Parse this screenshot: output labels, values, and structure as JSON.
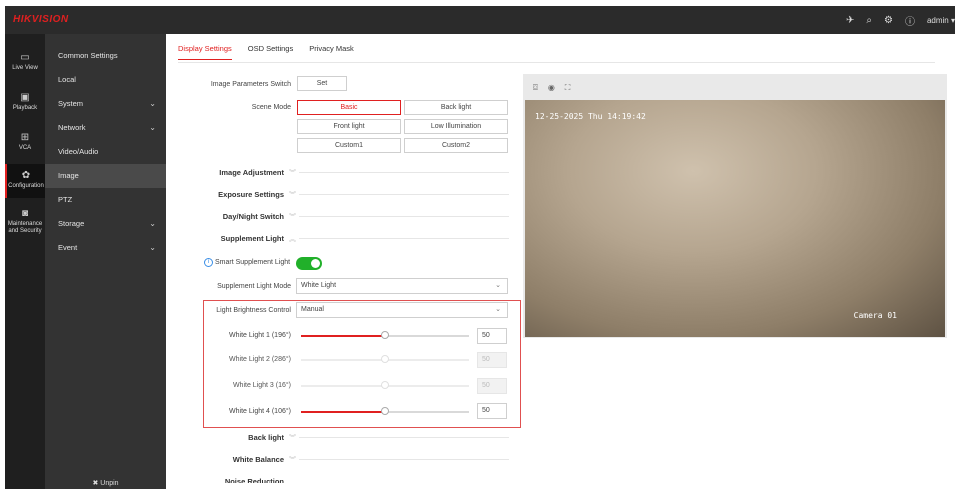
{
  "brand": "HIKVISION",
  "topbar": {
    "user": "admin"
  },
  "leftnav": [
    {
      "label": "Live View",
      "icon": "monitor-icon"
    },
    {
      "label": "Playback",
      "icon": "play-icon"
    },
    {
      "label": "VCA",
      "icon": "vca-icon"
    },
    {
      "label": "Configuration",
      "icon": "gear-icon"
    },
    {
      "label": "Maintenance and Security",
      "icon": "maintenance-icon"
    }
  ],
  "menu": [
    {
      "label": "Common Settings"
    },
    {
      "label": "Local"
    },
    {
      "label": "System"
    },
    {
      "label": "Network"
    },
    {
      "label": "Video/Audio"
    },
    {
      "label": "Image"
    },
    {
      "label": "PTZ"
    },
    {
      "label": "Storage"
    },
    {
      "label": "Event"
    }
  ],
  "unpin": "Unpin",
  "tabs": [
    "Display Settings",
    "OSD Settings",
    "Privacy Mask"
  ],
  "form": {
    "image_params_label": "Image Parameters Switch",
    "set_button": "Set",
    "scene_mode_label": "Scene Mode",
    "scene_options": [
      "Basic",
      "Back light",
      "Front light",
      "Low Illumination",
      "Custom1",
      "Custom2"
    ],
    "sections": [
      "Image Adjustment",
      "Exposure Settings",
      "Day/Night Switch",
      "Supplement Light",
      "Back light",
      "White Balance",
      "Noise Reduction"
    ],
    "smart_supplement_label": "Smart Supplement Light",
    "smart_supplement_on": true,
    "supplement_mode_label": "Supplement Light Mode",
    "supplement_mode_value": "White Light",
    "brightness_control_label": "Light Brightness Control",
    "brightness_control_value": "Manual",
    "white_lights": [
      {
        "label": "White Light 1 (196°)",
        "value": "50",
        "enabled": true,
        "level": 50
      },
      {
        "label": "White Light 2 (286°)",
        "value": "50",
        "enabled": false,
        "level": 50
      },
      {
        "label": "White Light 3 (16°)",
        "value": "50",
        "enabled": false,
        "level": 50
      },
      {
        "label": "White Light 4 (106°)",
        "value": "50",
        "enabled": true,
        "level": 50
      }
    ]
  },
  "preview": {
    "osd_time": "12-25-2025 Thu 14:19:42",
    "osd_camera": "Camera 01"
  }
}
